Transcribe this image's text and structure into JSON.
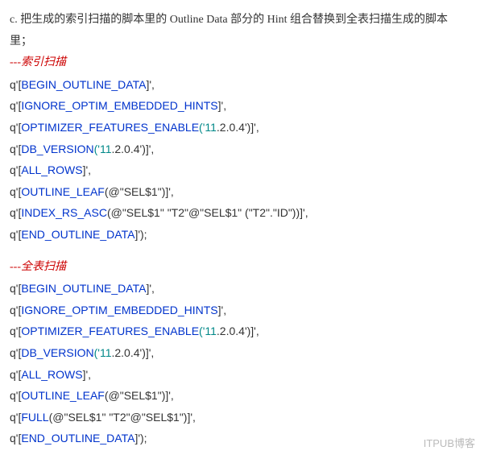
{
  "intro": "c. 把生成的索引扫描的脚本里的 Outline Data 部分的 Hint 组合替换到全表扫描生成的脚本里；",
  "section1": {
    "title": "---索引扫描",
    "lines": [
      {
        "q": "q'[",
        "blue": "BEGIN_OUTLINE_DATA",
        "tail": "]',"
      },
      {
        "q": "q'[",
        "blue": "IGNORE_OPTIM_EMBEDDED_HINTS",
        "tail": "]',"
      },
      {
        "q": "q'[",
        "blue": "OPTIMIZER_FEATURES_ENABLE",
        "teal": "('11",
        "num": ".2.0.4",
        "tail2": "')]',"
      },
      {
        "q": "q'[",
        "blue": "DB_VERSION",
        "teal": "('11",
        "num": ".2.0.4",
        "tail2": "')]',"
      },
      {
        "q": "q'[",
        "blue": "ALL_ROWS",
        "tail": "]',"
      },
      {
        "q": "q'[",
        "blue": "OUTLINE_LEAF",
        "rest": "(@\"SEL$1\")]',"
      },
      {
        "q": "q'[",
        "blue": "INDEX_RS_ASC",
        "rest": "(@\"SEL$1\" \"T2\"@\"SEL$1\" (\"T2\".\"ID\"))]',"
      },
      {
        "q": "q'[",
        "blue": "END_OUTLINE_DATA",
        "tail": "]');"
      }
    ]
  },
  "section2": {
    "title": "---全表扫描",
    "lines": [
      {
        "q": "q'[",
        "blue": "BEGIN_OUTLINE_DATA",
        "tail": "]',"
      },
      {
        "q": "q'[",
        "blue": "IGNORE_OPTIM_EMBEDDED_HINTS",
        "tail": "]',"
      },
      {
        "q": "q'[",
        "blue": "OPTIMIZER_FEATURES_ENABLE",
        "teal": "('11",
        "num": ".2.0.4",
        "tail2": "')]',"
      },
      {
        "q": "q'[",
        "blue": "DB_VERSION",
        "teal": "('11",
        "num": ".2.0.4",
        "tail2": "')]',"
      },
      {
        "q": "q'[",
        "blue": "ALL_ROWS",
        "tail": "]',"
      },
      {
        "q": "q'[",
        "blue": "OUTLINE_LEAF",
        "rest": "(@\"SEL$1\")]',"
      },
      {
        "q": "q'[",
        "blue": "FULL",
        "rest": "(@\"SEL$1\" \"T2\"@\"SEL$1\")]',"
      },
      {
        "q": "q'[",
        "blue": "END_OUTLINE_DATA",
        "tail": "]');"
      }
    ]
  },
  "watermark": "ITPUB博客"
}
